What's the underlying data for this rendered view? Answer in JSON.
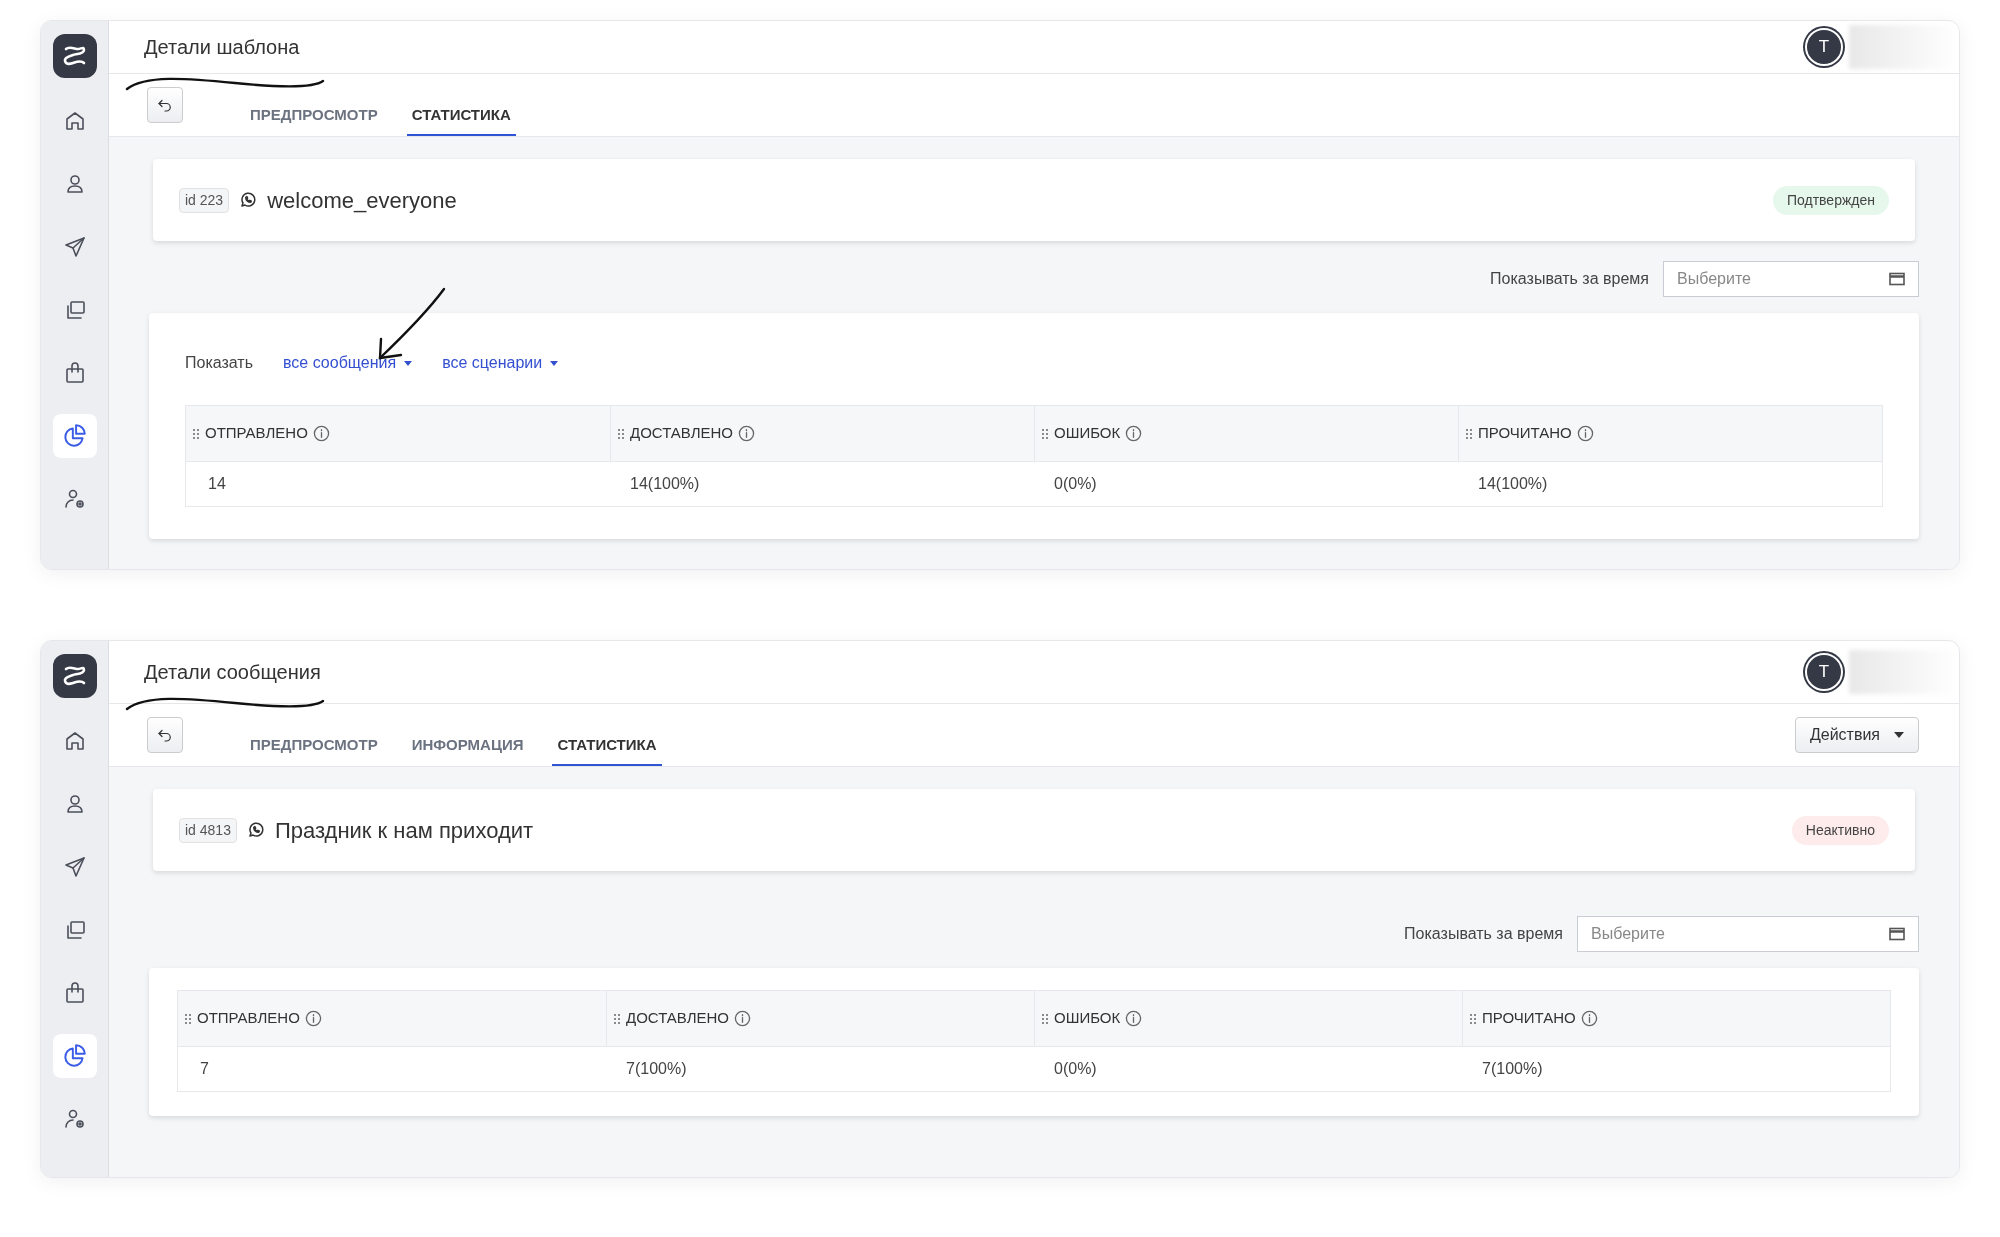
{
  "windows": [
    {
      "title": "Детали шаблона",
      "avatar": "T",
      "sidebar": {
        "items": [
          {
            "selected": false
          },
          {
            "selected": false
          },
          {
            "selected": false
          },
          {
            "selected": false
          },
          {
            "selected": false
          },
          {
            "selected": true
          },
          {
            "selected": false
          }
        ]
      },
      "tabs": [
        {
          "label": "ПРЕДПРОСМОТР",
          "selected": false
        },
        {
          "label": "СТАТИСТИКА",
          "selected": true
        }
      ],
      "record": {
        "id": "id 223",
        "name": "welcome_everyone",
        "status": {
          "label": "Подтвержден",
          "kind": "approved"
        }
      },
      "period": {
        "label": "Показывать за время",
        "placeholder": "Выберите"
      },
      "filters": {
        "label": "Показать",
        "options": [
          "все сообщения",
          "все сценарии"
        ]
      },
      "table": {
        "columns": [
          "ОТПРАВЛЕНО",
          "ДОСТАВЛЕНО",
          "ОШИБОК",
          "ПРОЧИТАНО"
        ],
        "rows": [
          [
            "14",
            "14(100%)",
            "0(0%)",
            "14(100%)"
          ]
        ]
      },
      "annotations": [
        {
          "kind": "underline"
        },
        {
          "kind": "arrow"
        }
      ]
    },
    {
      "title": "Детали сообщения",
      "avatar": "T",
      "sidebar": {
        "items": [
          {
            "selected": false
          },
          {
            "selected": false
          },
          {
            "selected": false
          },
          {
            "selected": false
          },
          {
            "selected": false
          },
          {
            "selected": true
          },
          {
            "selected": false
          }
        ]
      },
      "tabs": [
        {
          "label": "ПРЕДПРОСМОТР",
          "selected": false
        },
        {
          "label": "ИНФОРМАЦИЯ",
          "selected": false
        },
        {
          "label": "СТАТИСТИКА",
          "selected": true
        }
      ],
      "actions_button": "Действия",
      "record": {
        "id": "id 4813",
        "name": "Праздник к нам приходит",
        "status": {
          "label": "Неактивно",
          "kind": "inactive"
        }
      },
      "period": {
        "label": "Показывать за время",
        "placeholder": "Выберите"
      },
      "table": {
        "columns": [
          "ОТПРАВЛЕНО",
          "ДОСТАВЛЕНО",
          "ОШИБОК",
          "ПРОЧИТАНО"
        ],
        "rows": [
          [
            "7",
            "7(100%)",
            "0(0%)",
            "7(100%)"
          ]
        ]
      },
      "annotations": [
        {
          "kind": "underline"
        }
      ]
    }
  ]
}
